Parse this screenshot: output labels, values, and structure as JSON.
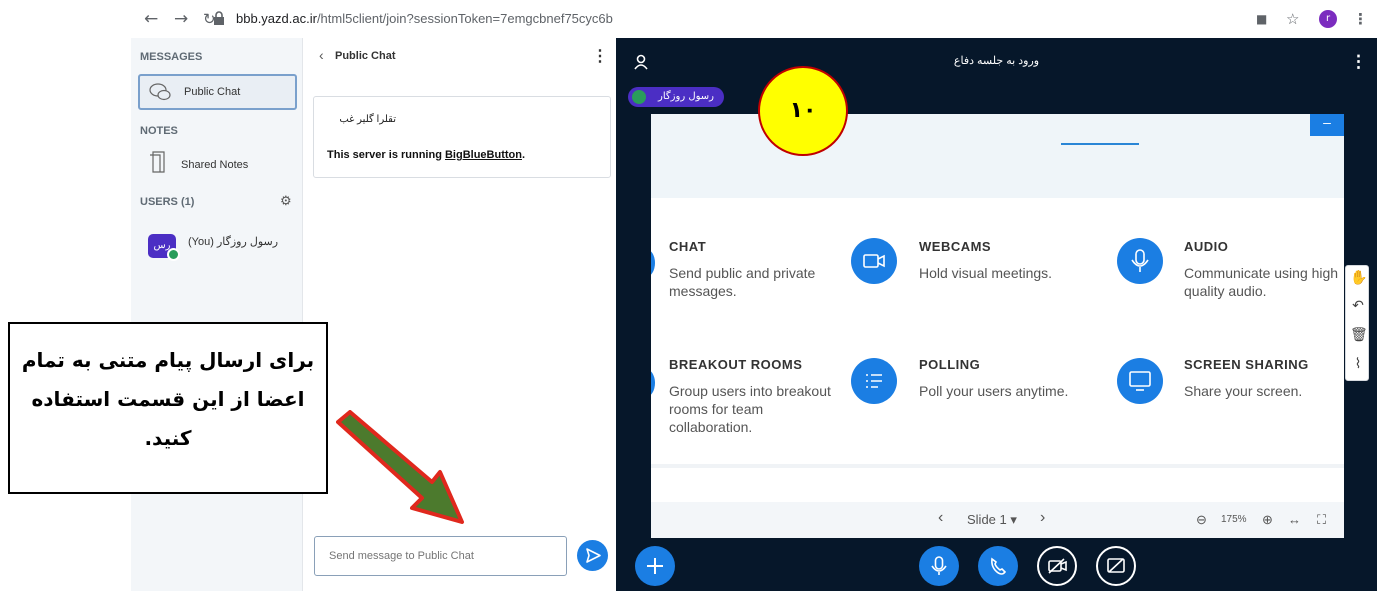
{
  "browser": {
    "url_host": "bbb.yazd.ac.ir",
    "url_path": "/html5client/join?sessionToken=7emgcbnef75cyc6b",
    "profile_initial": "r"
  },
  "userlist": {
    "messages_header": "MESSAGES",
    "public_chat_label": "Public Chat",
    "notes_header": "NOTES",
    "shared_notes_label": "Shared Notes",
    "users_header": "USERS (1)",
    "user": {
      "initials": "رس",
      "name": "(You) رسول روزگار"
    }
  },
  "chat": {
    "title": "Public Chat",
    "welcome_title": "تقلرا گلیر غب",
    "welcome_text_prefix": "This server is running ",
    "welcome_link": "BigBlueButton",
    "welcome_text_suffix": ".",
    "input_placeholder": "Send message to Public Chat"
  },
  "presentation": {
    "title": "ورود به جلسه دفاع",
    "presenter_chip": "رسول روزگار",
    "toggle_label": "–",
    "features": [
      {
        "title": "CHAT",
        "desc": "Send public and private messages.",
        "icon": "chat-icon"
      },
      {
        "title": "WEBCAMS",
        "desc": "Hold visual meetings.",
        "icon": "webcam-icon"
      },
      {
        "title": "AUDIO",
        "desc": "Communicate using high quality audio.",
        "icon": "microphone-icon"
      },
      {
        "title": "BREAKOUT ROOMS",
        "desc": "Group users into breakout rooms for team collaboration.",
        "icon": "breakout-icon"
      },
      {
        "title": "POLLING",
        "desc": "Poll your users anytime.",
        "icon": "poll-icon"
      },
      {
        "title": "SCREEN SHARING",
        "desc": "Share your screen.",
        "icon": "screen-share-icon"
      }
    ],
    "slide_label": "Slide 1",
    "zoom_label": "175%"
  },
  "annotation": {
    "badge_number": "۱۰",
    "note_text": "برای ارسال پیام متنی به تمام اعضا از این قسمت استفاده کنید.",
    "arrow_color": "#4c7a2d",
    "arrow_border": "#e0281d"
  },
  "colors": {
    "accent": "#1b7ee3",
    "presenter": "#4b2ec4",
    "presentation_bg": "#06172a"
  }
}
